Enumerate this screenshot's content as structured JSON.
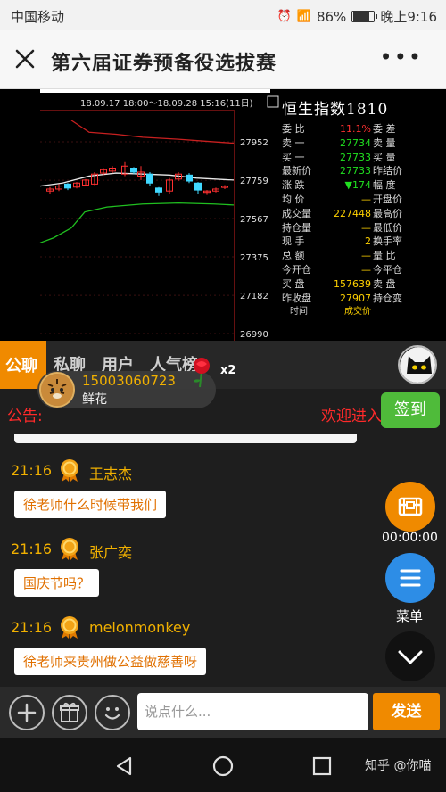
{
  "status_bar": {
    "carrier": "中国移动",
    "signal": "4G",
    "battery_percent": "86%",
    "battery_level": 0.86,
    "time": "晚上9:16"
  },
  "nav": {
    "title": "第六届证券预备役选拔赛",
    "more_label": "•••"
  },
  "chart": {
    "period_label": "18.09.17 18:00～18.09.28 15:16(11日)",
    "price_ticks": [
      "27952",
      "27759",
      "27567",
      "27375",
      "27182",
      "26990"
    ]
  },
  "chart_data": {
    "type": "candlestick",
    "period": "18.09.17 18:00～18.09.28 15:16(11日)",
    "ylim": [
      26990,
      27952
    ],
    "yticks": [
      27952,
      27759,
      27567,
      27375,
      27182,
      26990
    ],
    "grid": true
  },
  "quote": {
    "title": "恒生指数1810",
    "rows": [
      {
        "k": "委  比",
        "v": "11.1%",
        "k2": "委  差",
        "color": "c-red"
      },
      {
        "k": "卖  一",
        "v": "27734",
        "k2": "卖  量",
        "color": "c-green"
      },
      {
        "k": "买  一",
        "v": "27733",
        "k2": "买  量",
        "color": "c-green"
      },
      {
        "k": "最新价",
        "v": "27733",
        "k2": "昨结价",
        "color": "c-green"
      },
      {
        "k": "涨  跌",
        "v": "▼174",
        "k2": "幅  度",
        "color": "c-green"
      },
      {
        "k": "均  价",
        "v": "—",
        "k2": "开盘价",
        "color": "c-yellow"
      },
      {
        "k": "成交量",
        "v": "227448",
        "k2": "最高价",
        "color": "c-yellow"
      },
      {
        "k": "持仓量",
        "v": "—",
        "k2": "最低价",
        "color": "c-yellow"
      },
      {
        "k": "现  手",
        "v": "2",
        "k2": "换手率",
        "color": "c-yellow"
      },
      {
        "k": "总  额",
        "v": "—",
        "k2": "量  比",
        "color": "c-yellow"
      },
      {
        "k": "今开仓",
        "v": "—",
        "k2": "今平仓",
        "color": "c-yellow"
      },
      {
        "k": "买  盘",
        "v": "157639",
        "k2": "卖  盘",
        "color": "c-yellow"
      },
      {
        "k": "昨收盘",
        "v": "27907",
        "k2": "持仓变",
        "color": "c-yellow"
      }
    ],
    "footer_time": "时间",
    "footer_deal": "成交价"
  },
  "chat": {
    "tabs": [
      "公聊",
      "私聊",
      "用户",
      "人气榜"
    ],
    "gift": {
      "user": "15003060723",
      "name": "鲜花",
      "count": "x2"
    },
    "notice_label": "公告:",
    "notice_text": "欢迎进入",
    "checkin_label": "签到",
    "messages": [
      {
        "time": "21:16",
        "user": "王志杰",
        "text": "徐老师什么时候带我们"
      },
      {
        "time": "21:16",
        "user": "张广奕",
        "text": "国庆节吗？"
      },
      {
        "time": "21:16",
        "user": "melonmonkey",
        "text": "徐老师来贵州做公益做慈善呀"
      }
    ]
  },
  "floating": {
    "timer": "00:00:00",
    "menu_label": "菜单"
  },
  "input": {
    "placeholder": "说点什么...",
    "send_label": "发送"
  },
  "watermark": "知乎 @你喵"
}
